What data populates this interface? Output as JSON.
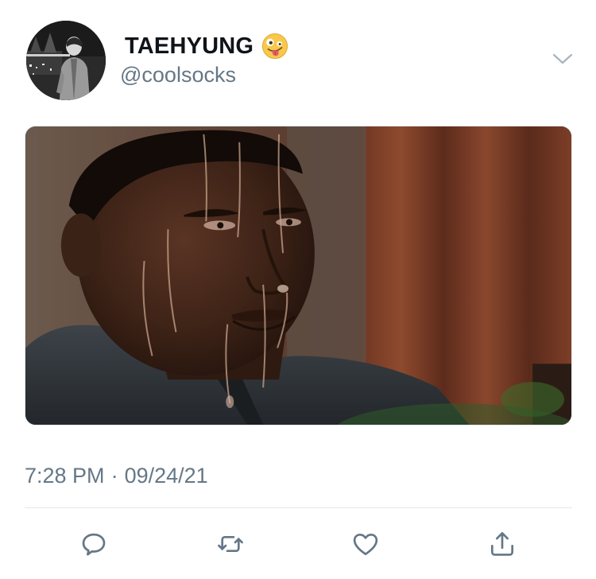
{
  "tweet": {
    "author": {
      "display_name": "TAEHYUNG",
      "handle": "@coolsocks",
      "name_emoji": "zany-face-emoji"
    },
    "timestamp": {
      "time": "7:28 PM",
      "separator": "·",
      "date": "09/24/21"
    },
    "media": {
      "kind": "image",
      "subject": "sweating-man-meme"
    },
    "actions": [
      {
        "name": "reply",
        "icon": "speech-bubble-icon"
      },
      {
        "name": "retweet",
        "icon": "retweet-arrows-icon"
      },
      {
        "name": "like",
        "icon": "heart-icon"
      },
      {
        "name": "share",
        "icon": "share-upload-icon"
      }
    ],
    "menu_icon": "chevron-down-icon"
  },
  "colors": {
    "text_primary": "#0f1419",
    "text_secondary": "#657786",
    "divider": "#e1e8ed",
    "icon": "#657786"
  }
}
